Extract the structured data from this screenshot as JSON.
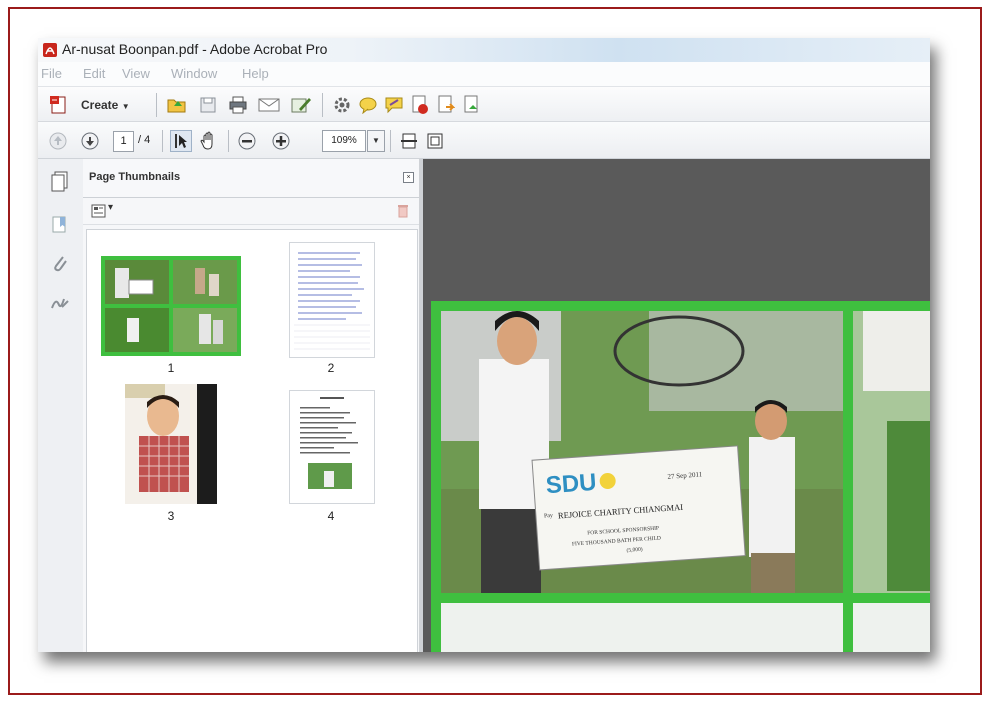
{
  "window": {
    "title": "Ar-nusat Boonpan.pdf - Adobe Acrobat Pro"
  },
  "menu": [
    {
      "label": "File"
    },
    {
      "label": "Edit"
    },
    {
      "label": "View"
    },
    {
      "label": "Window"
    },
    {
      "label": "Help"
    }
  ],
  "toolbar": {
    "create_label": "Create",
    "create_caret": "▼",
    "icons": [
      "open-folder-icon",
      "save-icon",
      "print-icon",
      "email-icon",
      "edit-pdf-icon",
      "settings-gear-icon",
      "comment-bubble-icon",
      "highlight-comment-icon",
      "export-pdf-icon",
      "share-icon",
      "sign-icon"
    ]
  },
  "navigation": {
    "current_page": "1",
    "total_pages": "/ 4",
    "zoom": "109%",
    "zoom_caret": "▼"
  },
  "panel": {
    "title": "Page Thumbnails",
    "close_glyph": "×",
    "options_caret": "▾"
  },
  "thumbnails": [
    {
      "label": "1"
    },
    {
      "label": "2"
    },
    {
      "label": "3"
    },
    {
      "label": "4"
    }
  ],
  "document": {
    "check_logo": "SDU",
    "check_date": "27 Sep 2011",
    "check_pay_label": "Pay",
    "check_payee": "REJOICE CHARITY CHIANGMAI",
    "check_purpose": "FOR SCHOOL SPONSORSHIP",
    "check_amount_words": "FIVE THOUSAND BATH PER CHILD",
    "check_footer": "(5,000)"
  },
  "colors": {
    "frame_border": "#9b1b1b",
    "photo_green": "#3fbf3f",
    "doc_background": "#5a5a5a"
  }
}
